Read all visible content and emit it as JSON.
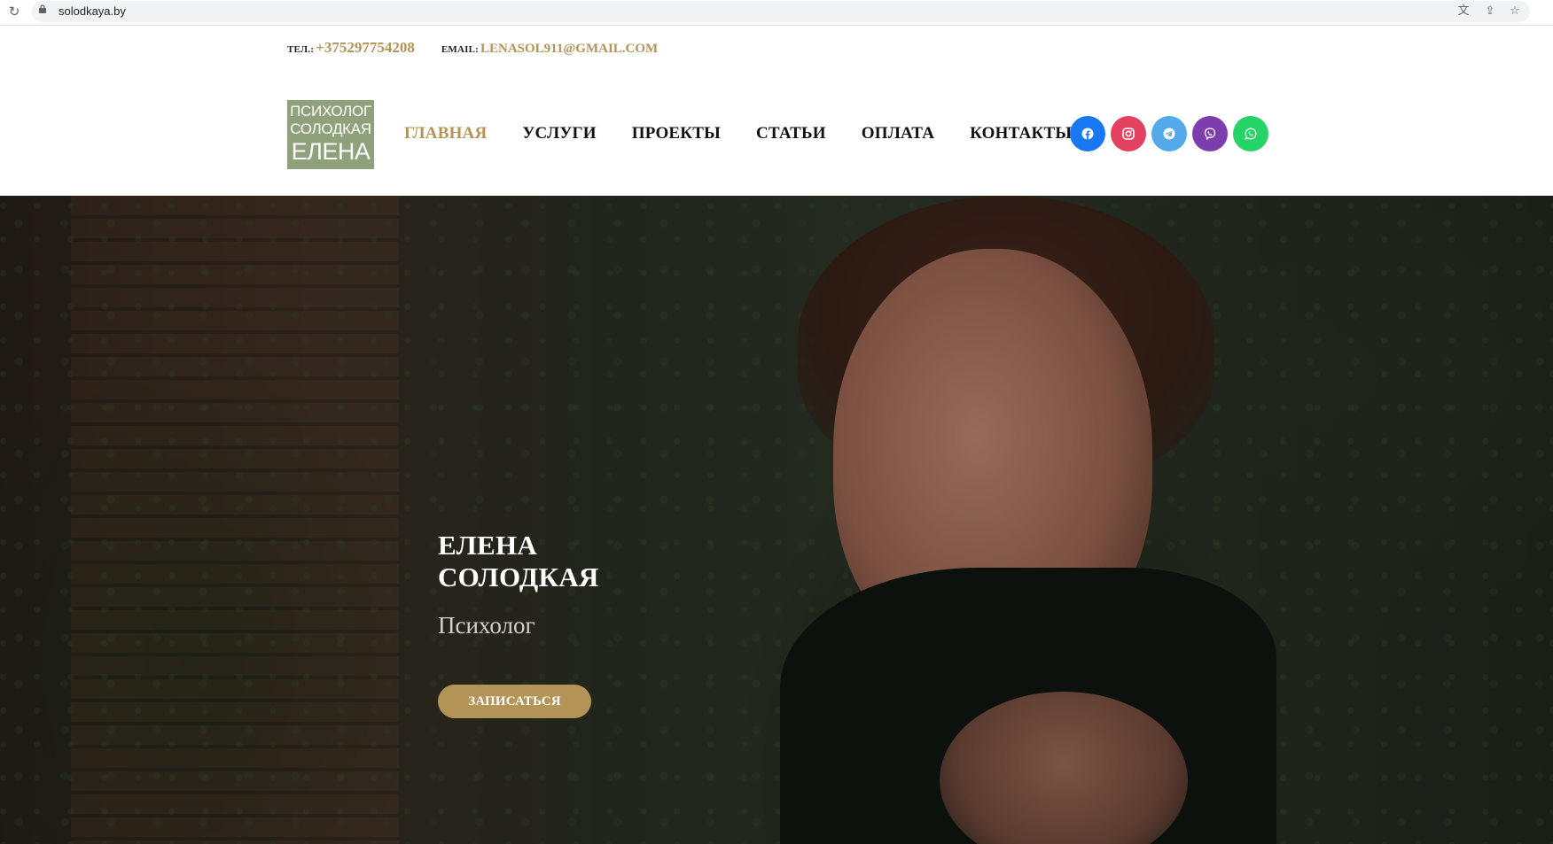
{
  "browser": {
    "url": "solodkaya.by"
  },
  "header": {
    "phone_label": "ТЕЛ.:",
    "phone": "+375297754208",
    "email_label": "EMAIL:",
    "email": "LENASOL911@GMAIL.COM",
    "logo": {
      "line1": "ПСИХОЛОГ",
      "line2": "СОЛОДКАЯ",
      "line3": "ЕЛЕНА"
    },
    "nav": [
      {
        "label": "ГЛАВНАЯ",
        "active": true
      },
      {
        "label": "УСЛУГИ",
        "active": false
      },
      {
        "label": "ПРОЕКТЫ",
        "active": false
      },
      {
        "label": "СТАТЬИ",
        "active": false
      },
      {
        "label": "ОПЛАТА",
        "active": false
      },
      {
        "label": "КОНТАКТЫ",
        "active": false
      }
    ],
    "socials": [
      {
        "name": "facebook-icon",
        "color": "#1877f2"
      },
      {
        "name": "instagram-icon",
        "color": "#e4405f"
      },
      {
        "name": "telegram-icon",
        "color": "#54a9eb"
      },
      {
        "name": "viber-icon",
        "color": "#7d3daf"
      },
      {
        "name": "whatsapp-icon",
        "color": "#25d366"
      }
    ]
  },
  "hero": {
    "title_line1": "ЕЛЕНА",
    "title_line2": "СОЛОДКАЯ",
    "subtitle": "Психолог",
    "cta": "ЗАПИСАТЬСЯ"
  },
  "colors": {
    "accent": "#b39456",
    "logo_bg": "#8fa17a"
  }
}
